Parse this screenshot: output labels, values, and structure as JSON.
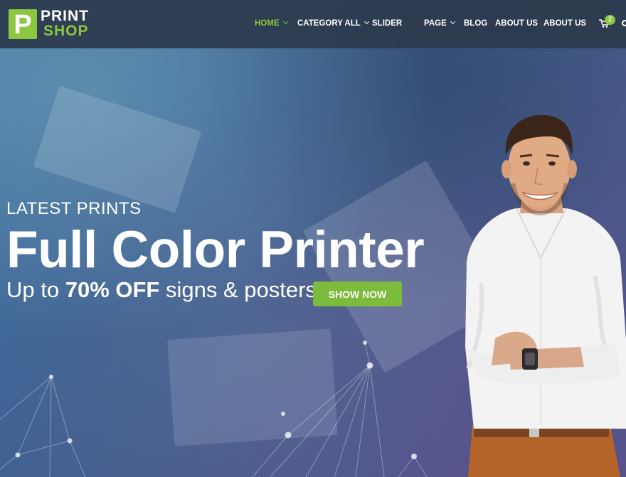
{
  "brand": {
    "logo_letter": "P",
    "logo_top": "PRINT",
    "logo_bottom": "SHOP"
  },
  "nav": {
    "items": [
      {
        "label": "HOME",
        "active": true,
        "has_dropdown": true
      },
      {
        "label": "CATEGORY ALL",
        "has_dropdown": true
      },
      {
        "label": "SLIDER"
      },
      {
        "label": "PAGE",
        "has_dropdown": true
      },
      {
        "label": "BLOG"
      },
      {
        "label": "ABOUT US"
      },
      {
        "label": "ABOUT US"
      }
    ],
    "cart_count": "2",
    "cart_icon": "shopping-cart-icon",
    "search_icon": "search-icon"
  },
  "hero": {
    "eyebrow": "LATEST PRINTS",
    "headline": "Full Color Printer",
    "offer_prefix": "Up to ",
    "offer_highlight": "70% OFF",
    "offer_suffix": " signs & posters",
    "cta_label": "SHOW NOW"
  },
  "colors": {
    "accent": "#8dc63f",
    "nav_bg": "#2c3a4c",
    "hero_overlay": "#3f6596",
    "cta_bg": "#7cbb3c",
    "shirt": "#f4f4f4",
    "pants": "#b5652a"
  }
}
